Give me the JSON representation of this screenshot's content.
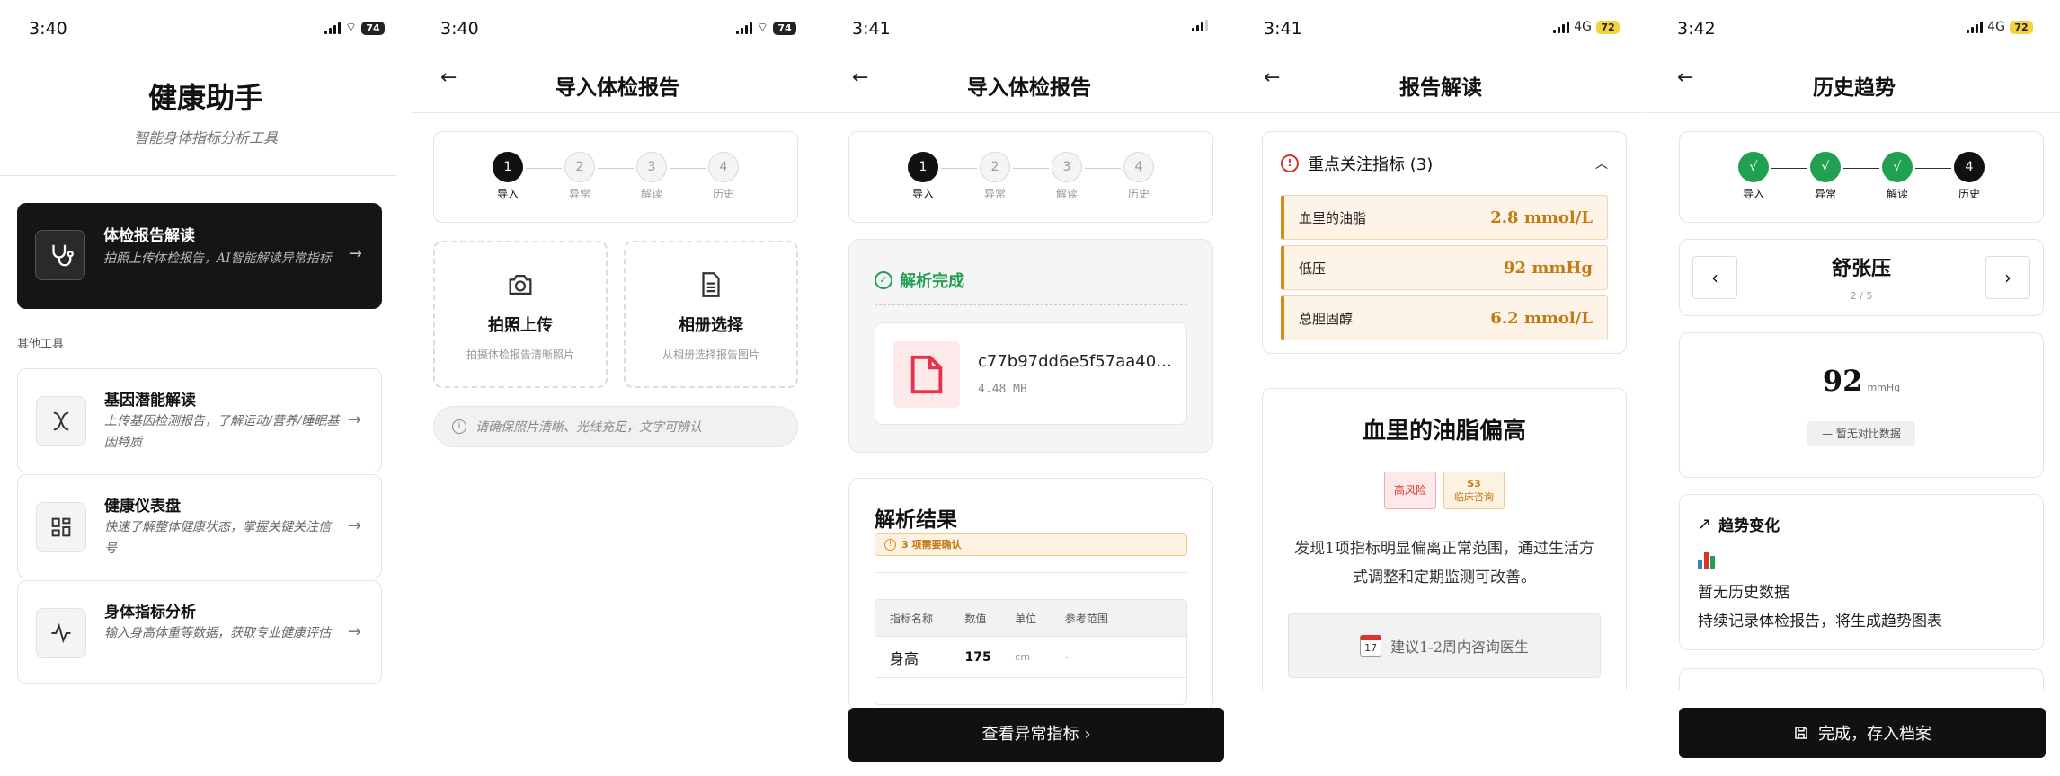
{
  "s1": {
    "time": "3:40",
    "battery": "74",
    "title": "健康助手",
    "subtitle": "智能身体指标分析工具",
    "feature": {
      "title": "体检报告解读",
      "desc": "拍照上传体检报告，AI智能解读异常指标",
      "icon": "stethoscope-icon"
    },
    "section": "其他工具",
    "tools": [
      {
        "title": "基因潜能解读",
        "desc": "上传基因检测报告，了解运动/营养/睡眠基因特质",
        "icon": "dna-icon"
      },
      {
        "title": "健康仪表盘",
        "desc": "快速了解整体健康状态，掌握关键关注信号",
        "icon": "dashboard-icon"
      },
      {
        "title": "身体指标分析",
        "desc": "输入身高体重等数据，获取专业健康评估",
        "icon": "pulse-icon"
      }
    ]
  },
  "s2": {
    "time": "3:40",
    "battery": "74",
    "title": "导入体检报告",
    "steps": [
      {
        "n": "1",
        "label": "导入"
      },
      {
        "n": "2",
        "label": "异常"
      },
      {
        "n": "3",
        "label": "解读"
      },
      {
        "n": "4",
        "label": "历史"
      }
    ],
    "photo": {
      "title": "拍照上传",
      "desc": "拍摄体检报告清晰照片"
    },
    "album": {
      "title": "相册选择",
      "desc": "从相册选择报告图片"
    },
    "tip": "请确保照片清晰、光线充足，文字可辨认"
  },
  "s3": {
    "time": "3:41",
    "title": "导入体检报告",
    "done": "解析完成",
    "file_name": "c77b97dd6e5f57aa40…",
    "file_size": "4.48 MB",
    "result_title": "解析结果",
    "confirm": "3 项需要确认",
    "table": {
      "headers": [
        "指标名称",
        "数值",
        "单位",
        "参考范围"
      ],
      "rows": [
        [
          "身高",
          "175",
          "cm",
          "-"
        ]
      ]
    },
    "cta": "查看异常指标 ›"
  },
  "s4": {
    "time": "3:41",
    "network": "4G",
    "battery": "72",
    "title": "报告解读",
    "focus": "重点关注指标 (3)",
    "items": [
      {
        "name": "血里的油脂",
        "value": "2.8 mmol/L"
      },
      {
        "name": "低压",
        "value": "92 mmHg"
      },
      {
        "name": "总胆固醇",
        "value": "6.2 mmol/L"
      }
    ],
    "card_title": "血里的油脂偏高",
    "risk": "高风险",
    "clinical_num": "S3",
    "clinical": "临床咨询",
    "desc": "发现1项指标明显偏离正常范围，通过生活方式调整和定期监测可改善。",
    "advice": "建议1-2周内咨询医生"
  },
  "s5": {
    "time": "3:42",
    "network": "4G",
    "battery": "72",
    "title": "历史趋势",
    "steps": [
      {
        "n": "√",
        "label": "导入"
      },
      {
        "n": "√",
        "label": "异常"
      },
      {
        "n": "√",
        "label": "解读"
      },
      {
        "n": "4",
        "label": "历史"
      }
    ],
    "metric": "舒张压",
    "pager": "2 / 5",
    "value": "92",
    "unit": "mmHg",
    "compare": "— 暂无对比数据",
    "trend_title": "趋势变化",
    "empty": "暂无历史数据",
    "empty_desc": "持续记录体检报告，将生成趋势图表",
    "cta": "完成，存入档案"
  }
}
